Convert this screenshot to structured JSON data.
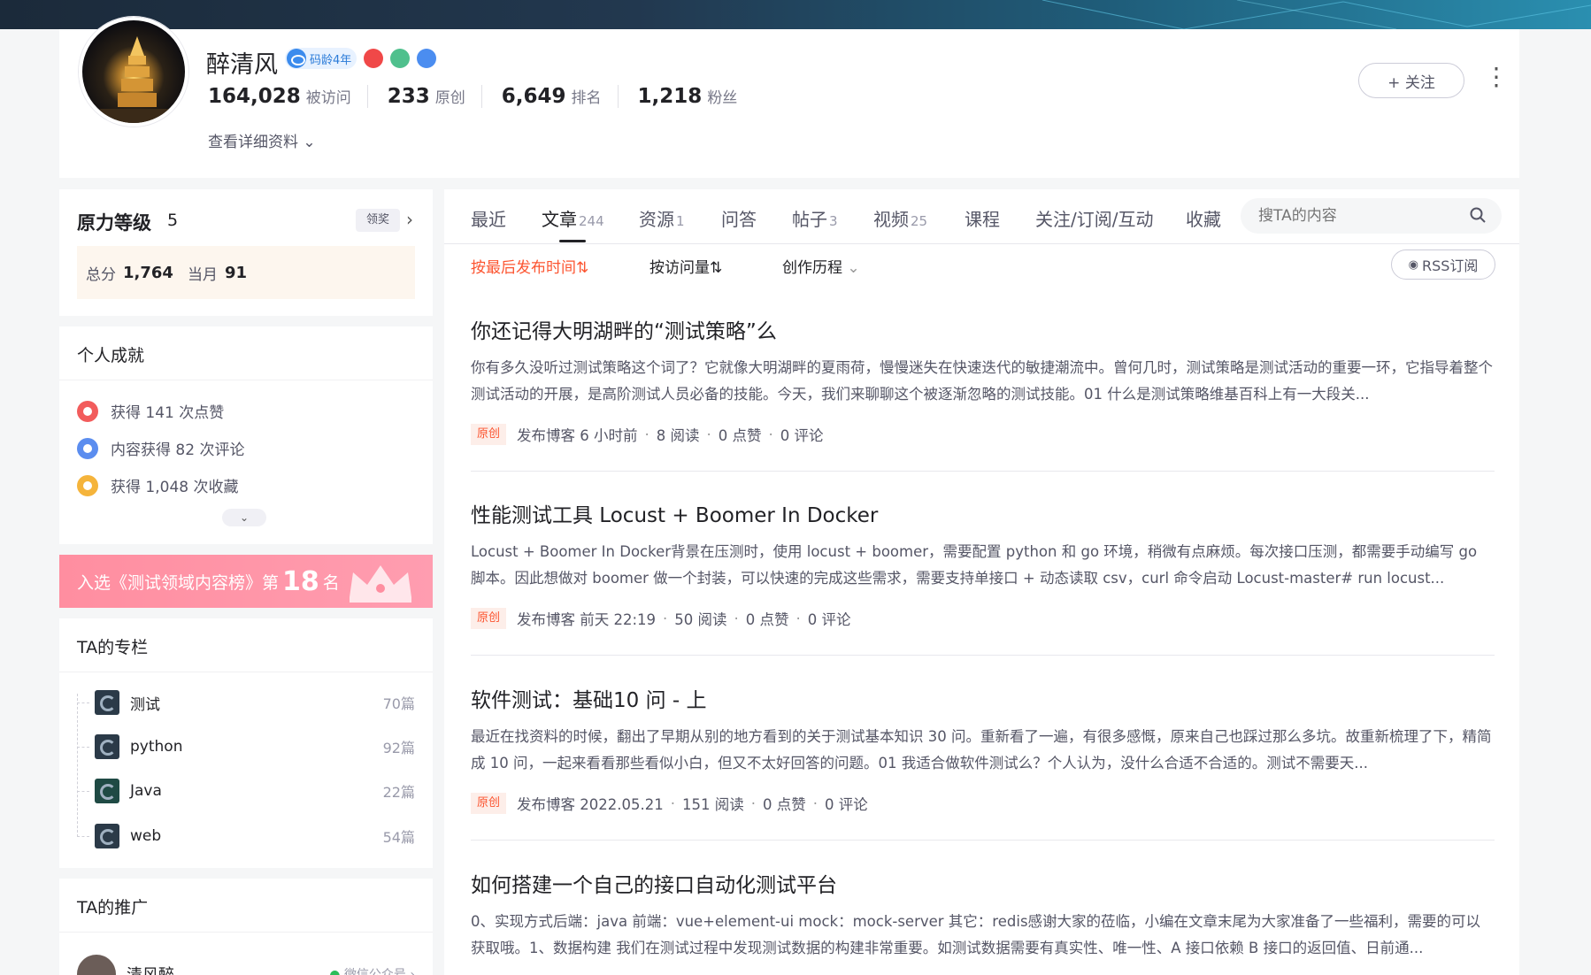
{
  "profile": {
    "name": "醉清风",
    "badge_age": "码龄4年",
    "stats": [
      {
        "num": "164,028",
        "label": "被访问"
      },
      {
        "num": "233",
        "label": "原创"
      },
      {
        "num": "6,649",
        "label": "排名"
      },
      {
        "num": "1,218",
        "label": "粉丝"
      }
    ],
    "detail_link": "查看详细资料",
    "follow_label": "+ 关注",
    "more_label": "⋮"
  },
  "level": {
    "title": "原力等级",
    "value": "5",
    "award_label": "领奖",
    "total_label": "总分",
    "total_value": "1,764",
    "month_label": "当月",
    "month_value": "91"
  },
  "achievements": {
    "title": "个人成就",
    "items": [
      {
        "text": "获得 141 次点赞",
        "color": "#f25c5c"
      },
      {
        "text": "内容获得 82 次评论",
        "color": "#5b8def"
      },
      {
        "text": "获得 1,048 次收藏",
        "color": "#f5b43b"
      }
    ]
  },
  "rank_banner": {
    "prefix": "入选《测试领域内容榜》第",
    "rank": "18",
    "suffix": "名"
  },
  "columns": {
    "title": "TA的专栏",
    "items": [
      {
        "name": "测试",
        "count": "70篇"
      },
      {
        "name": "python",
        "count": "92篇"
      },
      {
        "name": "Java",
        "count": "22篇"
      },
      {
        "name": "web",
        "count": "54篇"
      }
    ]
  },
  "promo": {
    "title": "TA的推广",
    "user_name": "清风醉",
    "channel": "微信公众号"
  },
  "tabs": [
    {
      "label": "最近",
      "count": ""
    },
    {
      "label": "文章",
      "count": "244"
    },
    {
      "label": "资源",
      "count": "1"
    },
    {
      "label": "问答",
      "count": ""
    },
    {
      "label": "帖子",
      "count": "3"
    },
    {
      "label": "视频",
      "count": "25"
    },
    {
      "label": "课程",
      "count": ""
    },
    {
      "label": "关注/订阅/互动",
      "count": ""
    },
    {
      "label": "收藏",
      "count": ""
    }
  ],
  "search": {
    "placeholder": "搜TA的内容"
  },
  "sort": {
    "by_time": "按最后发布时间⇅",
    "by_views": "按访问量⇅",
    "history": "创作历程"
  },
  "rss_label": "RSS订阅",
  "articles": [
    {
      "title": "你还记得大明湖畔的“测试策略”么",
      "desc": "你有多久没听过测试策略这个词了？它就像大明湖畔的夏雨荷，慢慢迷失在快速迭代的敏捷潮流中。曾何几时，测试策略是测试活动的重要一环，它指导着整个测试活动的开展，是高阶测试人员必备的技能。今天，我们来聊聊这个被逐渐忽略的测试技能。01 什么是测试策略维基百科上有一大段关...",
      "tag": "原创",
      "time": "发布博客 6 小时前",
      "views": "8 阅读",
      "likes": "0 点赞",
      "comments": "0 评论"
    },
    {
      "title": "性能测试工具 Locust + Boomer In Docker",
      "desc": "Locust + Boomer In Docker背景在压测时，使用 locust + boomer，需要配置 python 和 go 环境，稍微有点麻烦。每次接口压测，都需要手动编写 go 脚本。因此想做对 boomer 做一个封装，可以快速的完成这些需求，需要支持单接口 + 动态读取 csv，curl 命令启动 Locust-master# run locust...",
      "tag": "原创",
      "time": "发布博客 前天 22:19",
      "views": "50 阅读",
      "likes": "0 点赞",
      "comments": "0 评论"
    },
    {
      "title": "软件测试：基础10 问 - 上",
      "desc": "最近在找资料的时候，翻出了早期从别的地方看到的关于测试基本知识 30 问。重新看了一遍，有很多感慨，原来自己也踩过那么多坑。故重新梳理了下，精简成 10 问，一起来看看那些看似小白，但又不太好回答的问题。01 我适合做软件测试么？个人认为，没什么合适不合适的。测试不需要天...",
      "tag": "原创",
      "time": "发布博客 2022.05.21",
      "views": "151 阅读",
      "likes": "0 点赞",
      "comments": "0 评论"
    },
    {
      "title": "如何搭建一个自己的接口自动化测试平台",
      "desc": "0、实现方式后端：java 前端：vue+element-ui mock：mock-server 其它：redis感谢大家的莅临，小编在文章末尾为大家准备了一些福利，需要的可以获取哦。1、数据构建 我们在测试过程中发现测试数据的构建非常重要。如测试数据需要有真实性、唯一性、A 接口依赖 B 接口的返回值、日前通..."
    }
  ]
}
